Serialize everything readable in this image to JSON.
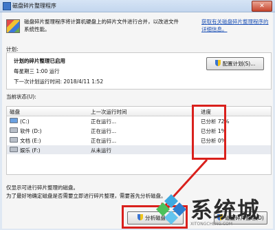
{
  "window": {
    "title": "磁盘碎片整理程序",
    "close_glyph": "✕"
  },
  "intro": {
    "description": "磁盘碎片整理程序将计算机硬盘上的碎片文件进行合并，以改进文件系统性能。",
    "help_link": "获取有关磁盘碎片整理程序的详细信息。"
  },
  "schedule": {
    "label": "计划:",
    "status": "计划的碎片整理已启用",
    "run_time": "每星期三 1:00 运行",
    "next_run": "下一次计划运行时间: 2018/4/11 1:52",
    "configure_button": "配置计划(S)..."
  },
  "current_status": {
    "label": "当前状态(U):",
    "columns": [
      "磁盘",
      "上一次运行时间",
      "进度"
    ],
    "rows": [
      {
        "disk": "(C:)",
        "last_run": "正在运行...",
        "progress": "已分析 72%",
        "icon": "windows-drive-icon"
      },
      {
        "disk": "软件 (D:)",
        "last_run": "正在运行...",
        "progress": "已分析 1%",
        "icon": "hard-drive-icon"
      },
      {
        "disk": "文档 (E:)",
        "last_run": "正在运行...",
        "progress": "已分析 0%",
        "icon": "hard-drive-icon"
      },
      {
        "disk": "娱乐 (F:)",
        "last_run": "从未运行",
        "progress": "",
        "icon": "hard-drive-icon"
      }
    ]
  },
  "footer": {
    "note1": "仅显示可进行碎片整理的磁盘。",
    "note2": "为了最好地确定磁盘是否需要立即进行碎片整理，需要首先分析磁盘。",
    "analyze_button": "分析磁盘(A)",
    "defrag_button": "磁盘碎片整理(D)"
  },
  "watermark": {
    "text": "系统城",
    "sub": "XITONGCHENG.COM"
  },
  "colors": {
    "highlight_box": "#d9201c",
    "link": "#1a4fb5",
    "title_bar": "#c3d6ee"
  }
}
